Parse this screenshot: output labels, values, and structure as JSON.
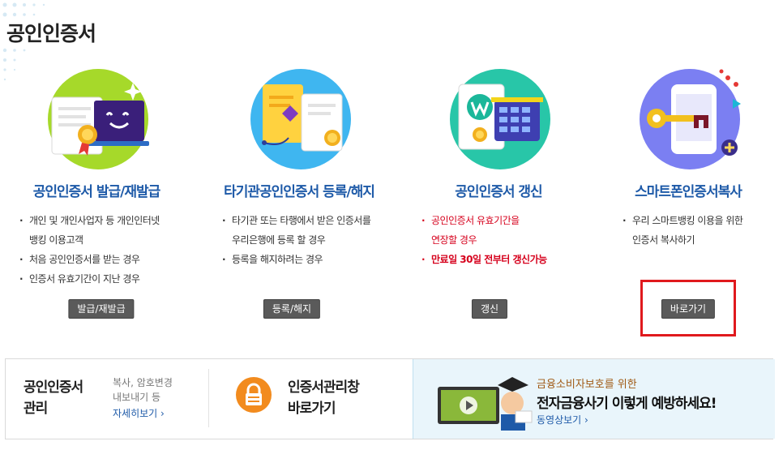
{
  "page": {
    "title": "공인인증서"
  },
  "cards": [
    {
      "title": "공인인증서 발급/재발급",
      "items": [
        "개인 및 개인사업자 등 개인인터넷",
        "뱅킹 이용고객",
        "처음 공인인증서를 받는 경우",
        "인증서 유효기간이 지난 경우"
      ],
      "button": "발급/재발급",
      "icon": "certificate-laptop-icon"
    },
    {
      "title": "타기관공인인증서 등록/해지",
      "items": [
        "타기관 또는 타행에서 받은 인증서를",
        "우리은행에 등록 할 경우",
        "등록을 해지하려는 경우"
      ],
      "button": "등록/해지",
      "icon": "certificate-scroll-icon"
    },
    {
      "title": "공인인증서 갱신",
      "items": [
        "공인인증서 유효기간을",
        "연장할 경우",
        "만료일 30일 전부터 갱신가능"
      ],
      "button": "갱신",
      "icon": "certificate-calculator-icon"
    },
    {
      "title": "스마트폰인증서복사",
      "items": [
        "우리 스마트뱅킹 이용을 위한",
        "인증서 복사하기"
      ],
      "button": "바로가기",
      "icon": "smartphone-key-icon"
    }
  ],
  "bottom": {
    "manage": {
      "title_line1": "공인인증서",
      "title_line2": "관리",
      "desc_line1": "복사, 암호변경",
      "desc_line2": "내보내기 등",
      "link": "자세히보기 ›"
    },
    "window": {
      "title_line1": "인증서관리창",
      "title_line2": "바로가기",
      "icon": "lock-icon"
    },
    "promo": {
      "small": "금융소비자보호를 위한",
      "big": "전자금융사기 이렇게 예방하세요!",
      "link": "동영상보기 ›"
    }
  },
  "colors": {
    "title_blue": "#1e5aa8",
    "highlight_red": "#e0191d",
    "button_gray": "#5a5a5a",
    "warning_red": "#d6001c"
  }
}
